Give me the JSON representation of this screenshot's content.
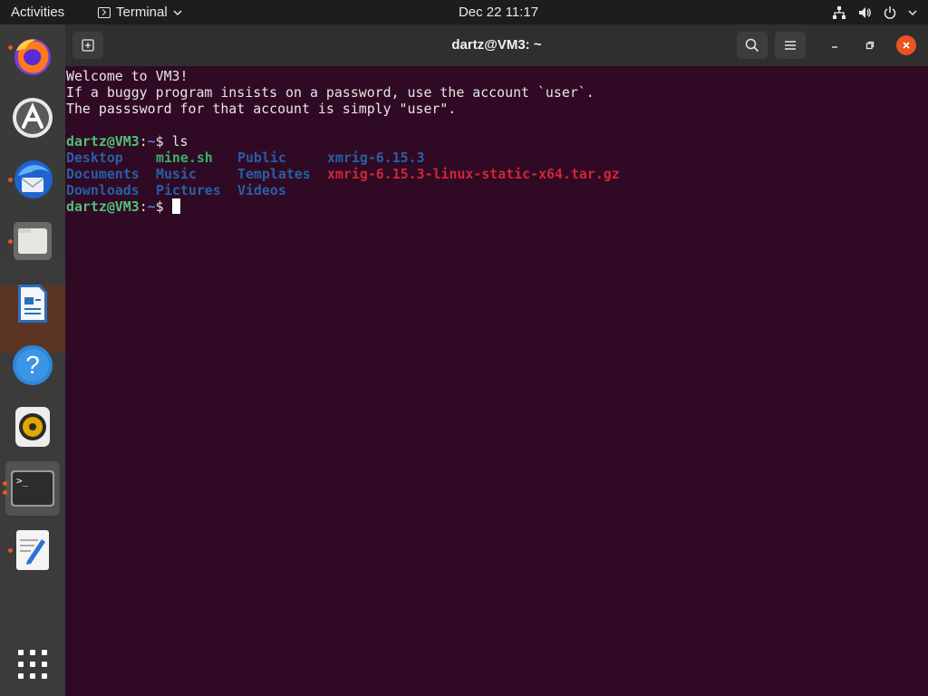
{
  "topbar": {
    "activities": "Activities",
    "app_name": "Terminal",
    "clock": "Dec 22  11:17"
  },
  "dock": {
    "items": [
      {
        "name": "Firefox",
        "icon": "firefox-icon",
        "running": true
      },
      {
        "name": "Ubuntu Software",
        "icon": "software-store-icon",
        "running": false
      },
      {
        "name": "Thunderbird",
        "icon": "thunderbird-icon",
        "running": true
      },
      {
        "name": "Files",
        "icon": "files-folder-icon",
        "running": true
      },
      {
        "name": "LibreOffice Writer",
        "icon": "writer-document-icon",
        "running": false
      },
      {
        "name": "Help",
        "icon": "help-icon",
        "running": false
      },
      {
        "name": "Rhythmbox",
        "icon": "speaker-icon",
        "running": false
      },
      {
        "name": "Terminal",
        "icon": "terminal-icon",
        "running": true,
        "active": true
      },
      {
        "name": "Text Editor",
        "icon": "text-editor-icon",
        "running": true
      },
      {
        "name": "Show Applications",
        "icon": "app-grid-icon",
        "running": false
      }
    ]
  },
  "window": {
    "title": "dartz@VM3: ~"
  },
  "terminal": {
    "motd": [
      "Welcome to VM3!",
      "If a buggy program insists on a password, use the account `user`.",
      "The passsword for that account is simply \"user\"."
    ],
    "prompt_user": "dartz@VM3",
    "prompt_sep": ":",
    "prompt_dir": "~",
    "prompt_symbol": "$ ",
    "command": "ls",
    "ls_rows": [
      [
        "Desktop",
        "mine.sh",
        "Public",
        "xmrig-6.15.3"
      ],
      [
        "Documents",
        "Music",
        "Templates",
        "xmrig-6.15.3-linux-static-x64.tar.gz"
      ],
      [
        "Downloads",
        "Pictures",
        "Videos",
        ""
      ]
    ]
  },
  "colors": {
    "terminal_bg": "#300a24",
    "prompt_user": "#4ec276",
    "directory": "#285ea8",
    "executable": "#3ab26a",
    "archive": "#d02636",
    "accent": "#e95420"
  }
}
